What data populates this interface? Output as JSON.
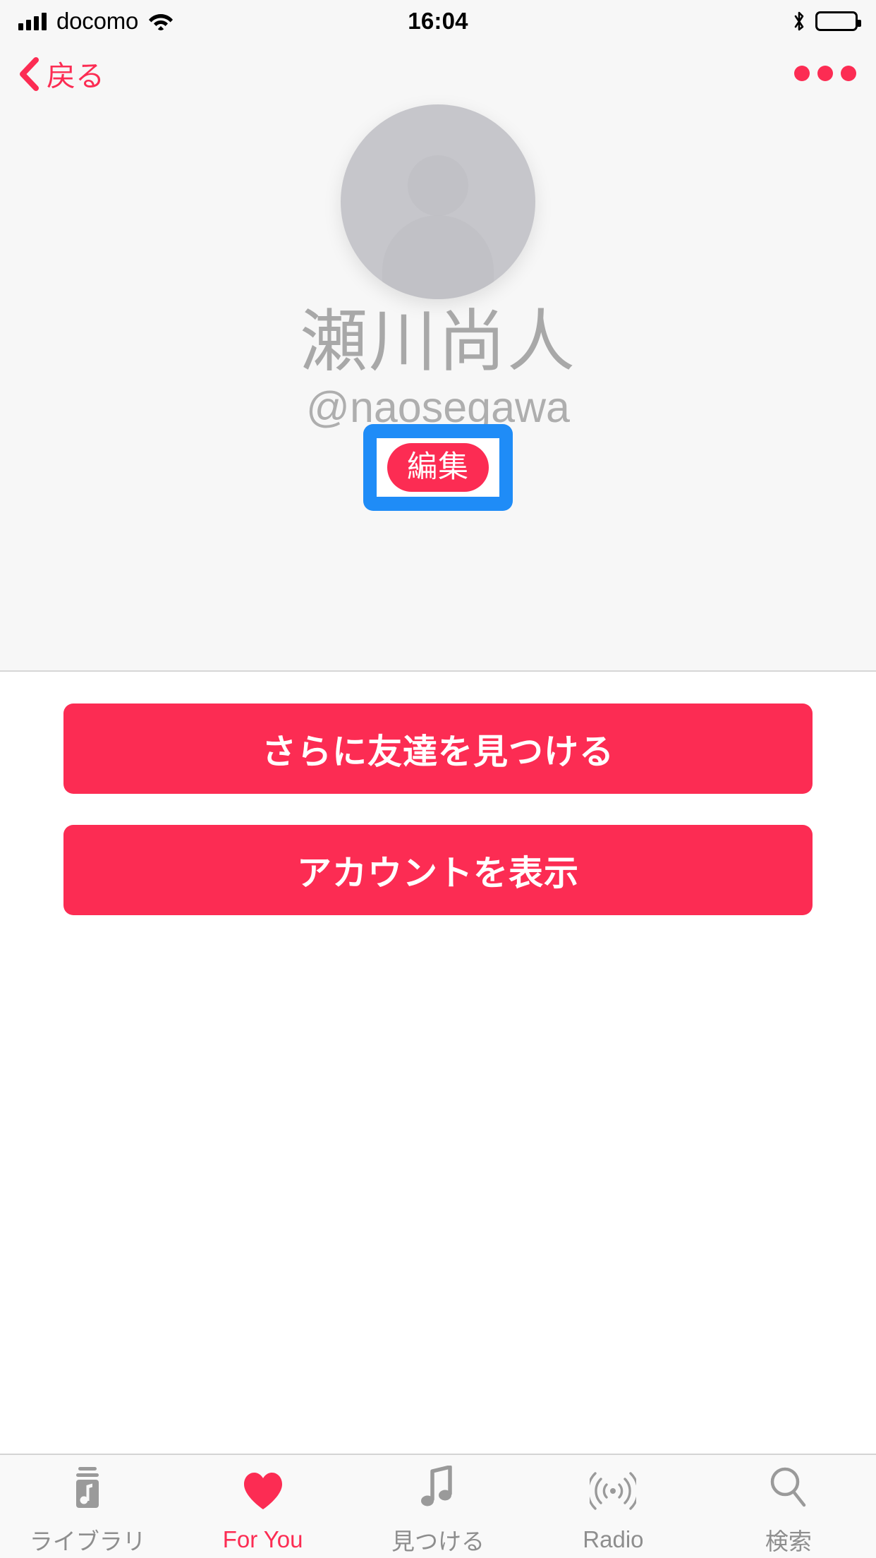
{
  "status_bar": {
    "carrier": "docomo",
    "time": "16:04",
    "signal_icon": "signal-bars-icon",
    "wifi_icon": "wifi-icon",
    "bluetooth_icon": "bluetooth-icon",
    "battery_icon": "battery-icon"
  },
  "navbar": {
    "back_label": "戻る",
    "back_icon": "chevron-left-icon",
    "more_icon": "more-horizontal-icon"
  },
  "profile": {
    "avatar_icon": "person-placeholder-avatar",
    "display_name": "瀬川尚人",
    "handle": "@naosegawa",
    "edit_label": "編集"
  },
  "actions": [
    {
      "label": "さらに友達を見つける",
      "name": "find-more-friends-button"
    },
    {
      "label": "アカウントを表示",
      "name": "view-account-button"
    }
  ],
  "tabbar": [
    {
      "label": "ライブラリ",
      "icon": "library-icon",
      "name": "tab-library",
      "active": false
    },
    {
      "label": "For You",
      "icon": "heart-icon",
      "name": "tab-for-you",
      "active": true
    },
    {
      "label": "見つける",
      "icon": "music-note-icon",
      "name": "tab-browse",
      "active": false
    },
    {
      "label": "Radio",
      "icon": "radio-waves-icon",
      "name": "tab-radio",
      "active": false
    },
    {
      "label": "検索",
      "icon": "search-icon",
      "name": "tab-search",
      "active": false
    }
  ],
  "colors": {
    "accent": "#fc2c53",
    "highlight_blue": "#1f8cf7",
    "header_bg": "#f7f7f7",
    "muted_text": "#a8a8a8"
  }
}
